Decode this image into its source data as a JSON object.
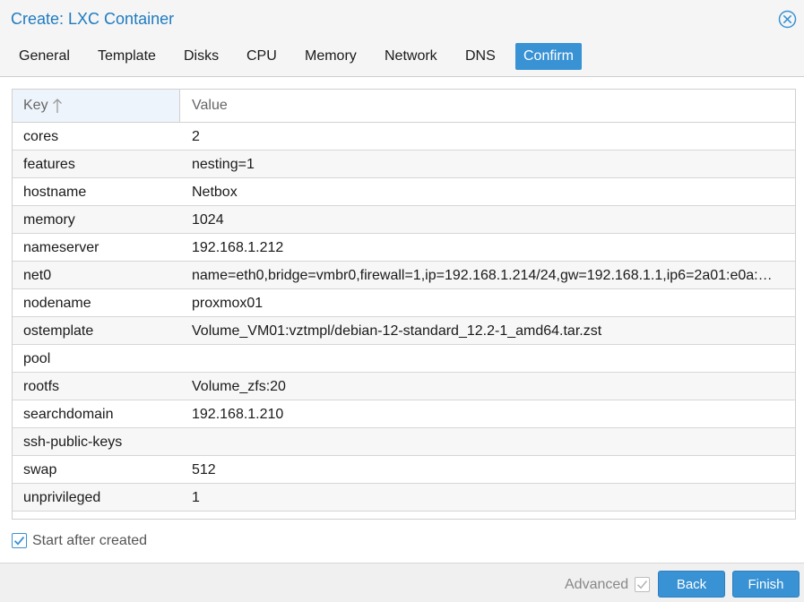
{
  "window": {
    "title": "Create: LXC Container"
  },
  "tabs": [
    {
      "label": "General"
    },
    {
      "label": "Template"
    },
    {
      "label": "Disks"
    },
    {
      "label": "CPU"
    },
    {
      "label": "Memory"
    },
    {
      "label": "Network"
    },
    {
      "label": "DNS"
    },
    {
      "label": "Confirm",
      "active": true
    }
  ],
  "grid": {
    "columns": {
      "key": "Key",
      "value": "Value"
    },
    "sort_column": "key",
    "sort_direction": "ascending",
    "rows": [
      {
        "key": "cores",
        "value": "2"
      },
      {
        "key": "features",
        "value": "nesting=1"
      },
      {
        "key": "hostname",
        "value": "Netbox"
      },
      {
        "key": "memory",
        "value": "1024"
      },
      {
        "key": "nameserver",
        "value": "192.168.1.212"
      },
      {
        "key": "net0",
        "value": "name=eth0,bridge=vmbr0,firewall=1,ip=192.168.1.214/24,gw=192.168.1.1,ip6=2a01:e0a:…"
      },
      {
        "key": "nodename",
        "value": "proxmox01"
      },
      {
        "key": "ostemplate",
        "value": "Volume_VM01:vztmpl/debian-12-standard_12.2-1_amd64.tar.zst"
      },
      {
        "key": "pool",
        "value": ""
      },
      {
        "key": "rootfs",
        "value": "Volume_zfs:20"
      },
      {
        "key": "searchdomain",
        "value": "192.168.1.210"
      },
      {
        "key": "ssh-public-keys",
        "value": ""
      },
      {
        "key": "swap",
        "value": "512"
      },
      {
        "key": "unprivileged",
        "value": "1"
      }
    ]
  },
  "options": {
    "start_after_created_label": "Start after created",
    "start_after_created_checked": true
  },
  "footer": {
    "advanced_label": "Advanced",
    "advanced_checked": true,
    "back_label": "Back",
    "finish_label": "Finish"
  },
  "colors": {
    "accent": "#3892d4",
    "title": "#1f7bc0"
  },
  "icons": {
    "close": "close-circle-icon",
    "sort": "arrow-up-icon",
    "check": "checkmark-icon"
  }
}
